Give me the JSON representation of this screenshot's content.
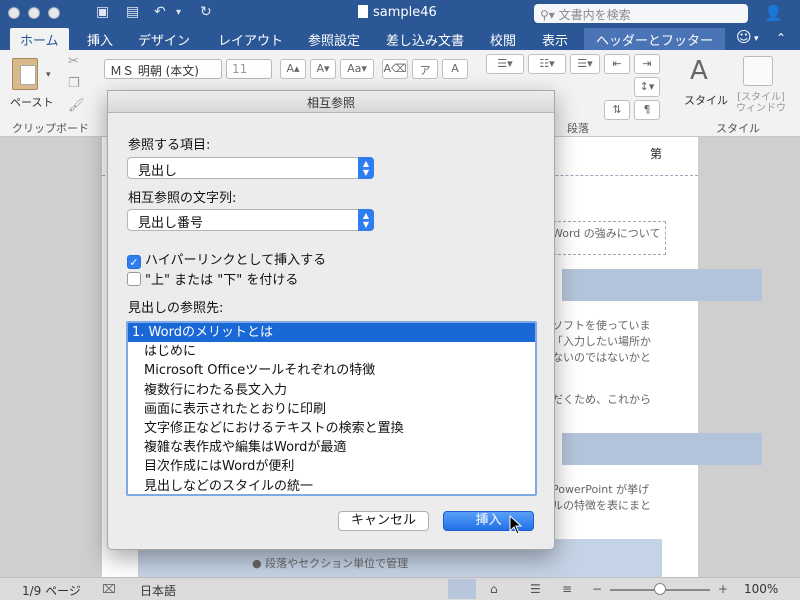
{
  "window": {
    "title": "sample46",
    "search_placeholder": "文書内を検索"
  },
  "ribbon_tabs": [
    {
      "label": "ホーム"
    },
    {
      "label": "挿入"
    },
    {
      "label": "デザイン"
    },
    {
      "label": "レイアウト"
    },
    {
      "label": "参照設定"
    },
    {
      "label": "差し込み文書"
    },
    {
      "label": "校閲"
    },
    {
      "label": "表示"
    },
    {
      "label": "ヘッダーとフッター"
    }
  ],
  "ribbon": {
    "paste_label": "ペースト",
    "clipboard_group": "クリップボード",
    "font_name": "ＭＳ 明朝 (本文)",
    "font_size": "11",
    "paragraph_group": "段落",
    "style_label": "スタイル",
    "style_pane_label": "[スタイル]\nウィンドウ",
    "style_group": "スタイル"
  },
  "document": {
    "header_text": "第",
    "header_box_text": "Word の強みについて",
    "lines": [
      "ソフトを使っていま",
      "「入力したい場所か",
      "ないのではないかと",
      "だくため、これから",
      "PowerPoint が挙げ",
      "ルの特徴を表にまと",
      "● 段落やセクション単位で管理"
    ]
  },
  "status": {
    "page": "1/9 ページ",
    "language": "日本語",
    "zoom": "100%",
    "zoom_level": 0.5
  },
  "dialog": {
    "title": "相互参照",
    "ref_type_label": "参照する項目:",
    "ref_type_value": "見出し",
    "ref_string_label": "相互参照の文字列:",
    "ref_string_value": "見出し番号",
    "hyperlink_label": "ハイパーリンクとして挿入する",
    "hyperlink_checked": true,
    "above_below_label": "\"上\" または \"下\" を付ける",
    "above_below_checked": false,
    "list_label": "見出しの参照先:",
    "items": [
      "1. Wordのメリットとは",
      "はじめに",
      "Microsoft Officeツールそれぞれの特徴",
      "複数行にわたる長文入力",
      "画面に表示されたとおりに印刷",
      "文字修正などにおけるテキストの検索と置換",
      "複雑な表作成や編集はWordが最適",
      "目次作成にはWordが便利",
      "見出しなどのスタイルの統一"
    ],
    "cancel_label": "キャンセル",
    "insert_label": "挿入"
  },
  "colors": {
    "accent": "#2b5797",
    "selection": "#1a67d6",
    "button_blue": "#2f7ef0"
  }
}
